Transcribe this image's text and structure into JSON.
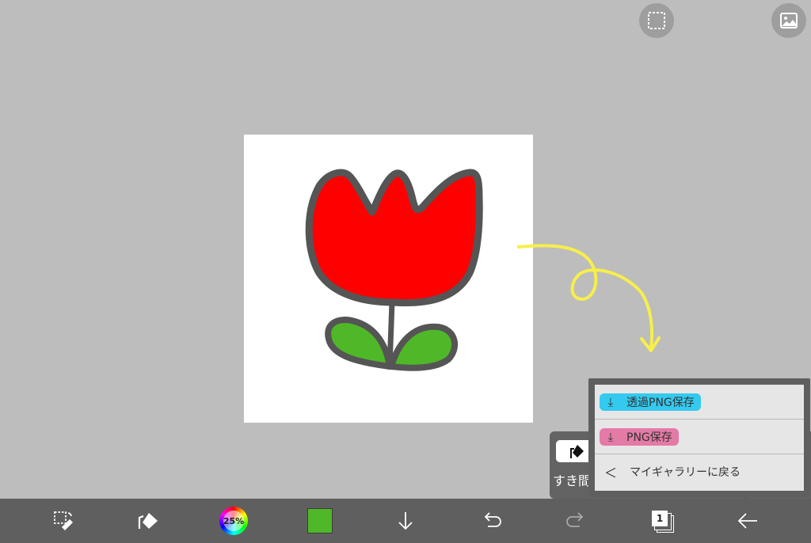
{
  "top_buttons": {
    "select_icon": "selection-icon",
    "image_icon": "image-icon"
  },
  "canvas": {
    "flower_red": "#ff0000",
    "leaf_green": "#4fb828",
    "outline": "#555555"
  },
  "annotation": {
    "color": "#f7ef4a"
  },
  "fill_panel": {
    "gap_label": "すき間"
  },
  "export_menu": {
    "items": [
      {
        "label": "透過PNG保存",
        "icon": "download-icon",
        "highlight": "#34c9ef"
      },
      {
        "label": "PNG保存",
        "icon": "download-icon",
        "highlight": "#e47aa6"
      },
      {
        "label": "マイギャラリーに戻る",
        "icon": "chevron-left-icon"
      }
    ]
  },
  "toolbar": {
    "brush_opacity": "25%",
    "current_color": "#4fb828",
    "layer_count": "1",
    "tools": [
      "transform-icon",
      "fill-icon",
      "color-wheel-icon",
      "color-swatch",
      "download-icon",
      "undo-icon",
      "redo-icon",
      "layers-icon",
      "back-arrow-icon"
    ]
  }
}
